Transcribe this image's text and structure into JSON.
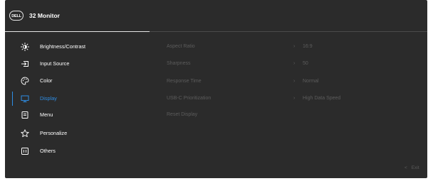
{
  "header": {
    "logo_text": "DELL",
    "title": "32 Monitor"
  },
  "menu": {
    "items": [
      {
        "label": "Brightness/Contrast",
        "icon": "brightness-icon"
      },
      {
        "label": "Input Source",
        "icon": "input-source-icon"
      },
      {
        "label": "Color",
        "icon": "color-palette-icon"
      },
      {
        "label": "Display",
        "icon": "display-icon"
      },
      {
        "label": "Menu",
        "icon": "menu-icon"
      },
      {
        "label": "Personalize",
        "icon": "star-icon"
      },
      {
        "label": "Others",
        "icon": "others-icon"
      }
    ],
    "selected": "Display"
  },
  "options": [
    {
      "label": "Aspect Ratio",
      "arrow": "›",
      "value": "16:9"
    },
    {
      "label": "Sharpness",
      "arrow": "›",
      "value": "50"
    },
    {
      "label": "Response Time",
      "arrow": "›",
      "value": "Normal"
    },
    {
      "label": "USB-C Prioritization",
      "arrow": "›",
      "value": "High Data Speed"
    },
    {
      "label": "Reset Display",
      "arrow": "",
      "value": ""
    }
  ],
  "footer": {
    "exit_chevron": "<",
    "exit_label": "Exit"
  },
  "colors": {
    "background": "#2b2b2b",
    "accent": "#2e8ee6",
    "text": "#ffffff",
    "dimmed": "#5c5c5c"
  }
}
